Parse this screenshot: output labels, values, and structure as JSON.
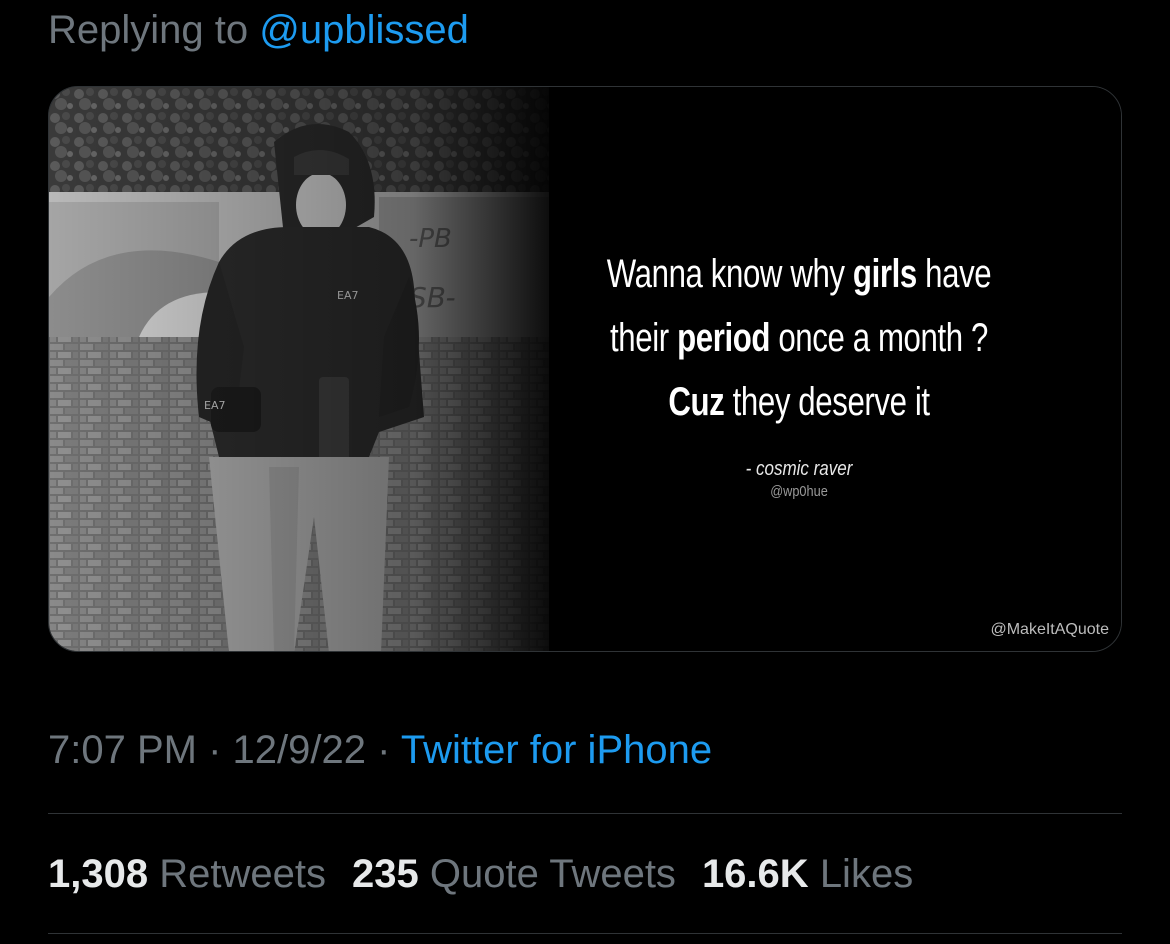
{
  "reply": {
    "prefix": "Replying to",
    "handle": "@upblissed"
  },
  "media": {
    "quote_lines": [
      {
        "before": "Wanna know why ",
        "bold": "girls",
        "after": " have"
      },
      {
        "before": "their ",
        "bold": "period",
        "after": " once a month ?"
      },
      {
        "before": "",
        "bold": "Cuz",
        "after": " they deserve it"
      }
    ],
    "author": "- cosmic raver",
    "author_handle": "@wp0hue",
    "watermark": "@MakeItAQuote",
    "photo_tags": [
      "EA7",
      "EA7"
    ]
  },
  "meta": {
    "time": "7:07 PM",
    "separator": "·",
    "date": "12/9/22",
    "source": "Twitter for iPhone"
  },
  "stats": {
    "retweets_count": "1,308",
    "retweets_label": "Retweets",
    "quotes_count": "235",
    "quotes_label": "Quote Tweets",
    "likes_count": "16.6K",
    "likes_label": "Likes"
  },
  "colors": {
    "background": "#000000",
    "secondary_text": "#6e767d",
    "link": "#1d9bf0",
    "primary_text": "#e7e9ea",
    "divider": "#2f3336"
  }
}
